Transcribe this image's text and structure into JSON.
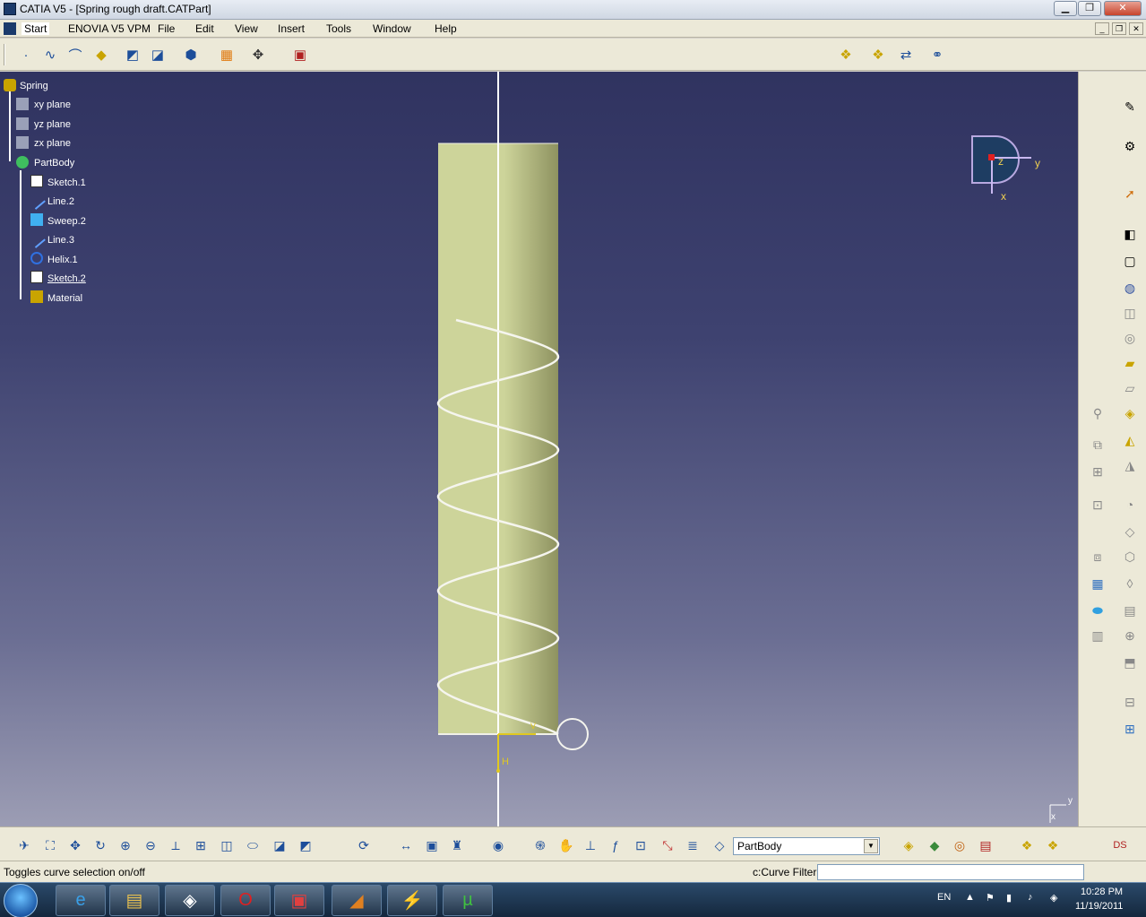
{
  "window": {
    "title": "CATIA V5 - [Spring rough draft.CATPart]",
    "minimize": "▁",
    "maximize": "❐",
    "close": "✕"
  },
  "menu": {
    "items": [
      "Start",
      "ENOVIA V5 VPM",
      "File",
      "Edit",
      "View",
      "Insert",
      "Tools",
      "Window",
      "Help"
    ]
  },
  "tree": {
    "root": "Spring",
    "items": [
      {
        "label": "xy plane",
        "icon": "plane-icon"
      },
      {
        "label": "yz plane",
        "icon": "plane-icon"
      },
      {
        "label": "zx plane",
        "icon": "plane-icon"
      },
      {
        "label": "PartBody",
        "icon": "partbody-icon"
      },
      {
        "label": "Sketch.1",
        "icon": "sketch-icon"
      },
      {
        "label": "Line.2",
        "icon": "line-icon"
      },
      {
        "label": "Sweep.2",
        "icon": "sweep-icon"
      },
      {
        "label": "Line.3",
        "icon": "line-icon"
      },
      {
        "label": "Helix.1",
        "icon": "helix-icon"
      },
      {
        "label": "Sketch.2",
        "icon": "sketch-icon"
      },
      {
        "label": "Material",
        "icon": "material-icon"
      }
    ]
  },
  "compass": {
    "z": "z",
    "y": "y",
    "x": "x"
  },
  "axis_labels": {
    "h": "H",
    "v": "V",
    "corner_y": "y",
    "corner_x": "x"
  },
  "bottom_toolbar": {
    "current_body": "PartBody"
  },
  "status": {
    "message": "Toggles curve selection on/off",
    "filter_label": "c:Curve Filter",
    "filter_value": ""
  },
  "taskbar": {
    "language": "EN",
    "time": "10:28 PM",
    "date": "11/19/2011"
  },
  "colors": {
    "cylinder": "#cdd49a",
    "viewport_top": "#303360",
    "viewport_bottom": "#9c9db4",
    "accent": "#f0d050"
  }
}
